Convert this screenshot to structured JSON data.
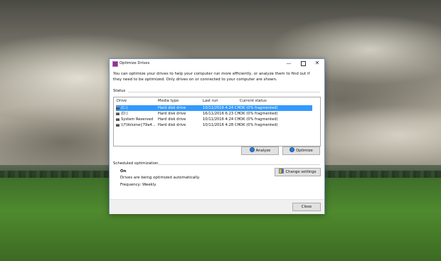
{
  "window": {
    "title": "Optimize Drives",
    "controls": {
      "minimize": "—",
      "maximize": "",
      "close": "✕"
    }
  },
  "description": "You can optimize your drives to help your computer run more efficiently, or analyze them to find out if they need to be optimized. Only drives on or connected to your computer are shown.",
  "status": {
    "label": "Status",
    "columns": [
      "Drive",
      "Media type",
      "Last run",
      "Current status"
    ],
    "rows": [
      {
        "drive": "(C:)",
        "media": "Hard disk drive",
        "last_run": "10/11/2016 4:24 CH",
        "status": "OK (0% fragmented)",
        "selected": true
      },
      {
        "drive": "(D:)",
        "media": "Hard disk drive",
        "last_run": "16/11/2016 6:23 CH",
        "status": "OK (0% fragmented)",
        "selected": false
      },
      {
        "drive": "System Reserved",
        "media": "Hard disk drive",
        "last_run": "10/11/2016 4:24 CH",
        "status": "OK (0% fragmented)",
        "selected": false
      },
      {
        "drive": "\\\\?\\Volume{79a4...",
        "media": "Hard disk drive",
        "last_run": "10/11/2016 4:28 CH",
        "status": "OK (0% fragmented)",
        "selected": false
      }
    ]
  },
  "buttons": {
    "analyze": "Analyze",
    "optimize": "Optimize",
    "change_settings": "Change settings",
    "close": "Close"
  },
  "scheduled": {
    "label": "Scheduled optimization",
    "state": "On",
    "text": "Drives are being optimized automatically.",
    "frequency": "Frequency: Weekly"
  },
  "colors": {
    "selection": "#3399ff",
    "window_border": "#6f8fb0"
  }
}
